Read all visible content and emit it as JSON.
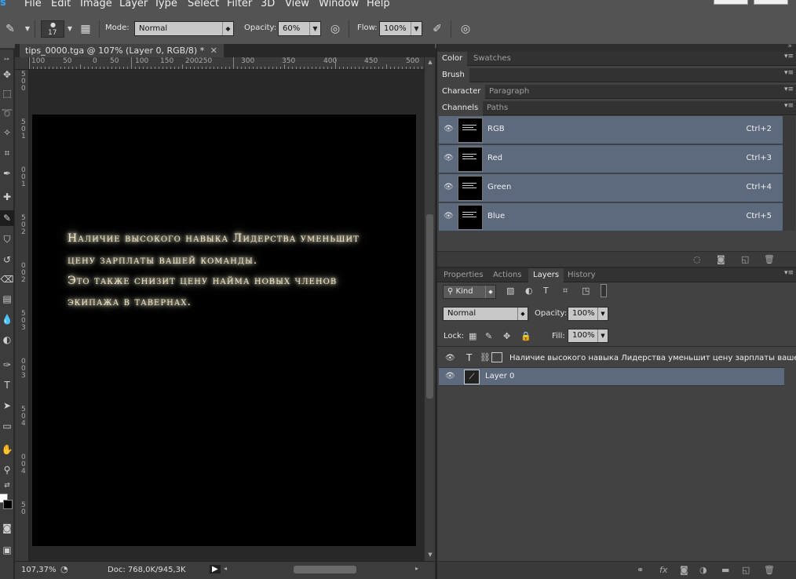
{
  "app": {
    "logo": "s"
  },
  "menu": [
    "File",
    "Edit",
    "Image",
    "Layer",
    "Type",
    "Select",
    "Filter",
    "3D",
    "View",
    "Window",
    "Help"
  ],
  "options": {
    "brush_size": "17",
    "mode_label": "Mode:",
    "mode_value": "Normal",
    "opacity_label": "Opacity:",
    "opacity_value": "60%",
    "flow_label": "Flow:",
    "flow_value": "100%"
  },
  "document": {
    "tab_title": "tips_0000.tga @ 107% (Layer 0, RGB/8) *",
    "ruler_h": [
      "100",
      "50",
      "0",
      "50",
      "100",
      "150",
      "200",
      "250",
      "300",
      "350",
      "400",
      "450",
      "500"
    ],
    "ruler_v": [
      "5",
      "0",
      "0",
      "5",
      "0",
      "1",
      "0",
      "0",
      "1",
      "5",
      "0",
      "2",
      "0",
      "0",
      "2",
      "5",
      "0",
      "3",
      "0",
      "0",
      "3",
      "5",
      "0",
      "4",
      "0",
      "0",
      "4",
      "5",
      "0"
    ],
    "text_lines": [
      "Наличие высокого навыка Лидерства уменьшит",
      "цену зарплаты вашей команды.",
      "Это также снизит цену найма новых членов",
      "экипажа в тавернах."
    ]
  },
  "status": {
    "zoom": "107,37%",
    "doc": "Doc: 768,0K/945,3K"
  },
  "panels": {
    "group1_tabs": [
      "Color",
      "Swatches"
    ],
    "group2_tabs": [
      "Brush"
    ],
    "group3_tabs": [
      "Character",
      "Paragraph"
    ],
    "group4_tabs": [
      "Channels",
      "Paths"
    ],
    "channels": [
      {
        "name": "RGB",
        "shortcut": "Ctrl+2"
      },
      {
        "name": "Red",
        "shortcut": "Ctrl+3"
      },
      {
        "name": "Green",
        "shortcut": "Ctrl+4"
      },
      {
        "name": "Blue",
        "shortcut": "Ctrl+5"
      }
    ],
    "group5_tabs": [
      "Properties",
      "Actions",
      "Layers",
      "History"
    ],
    "layers": {
      "kind_label": "Kind",
      "blend_mode": "Normal",
      "opacity_label": "Opacity:",
      "opacity_value": "100%",
      "lock_label": "Lock:",
      "fill_label": "Fill:",
      "fill_value": "100%",
      "items": [
        {
          "name": "Наличие высокого навыка Лидерства уменьшит цену зарплаты вашей",
          "type": "text"
        },
        {
          "name": "Layer 0",
          "type": "pixel"
        }
      ]
    }
  }
}
